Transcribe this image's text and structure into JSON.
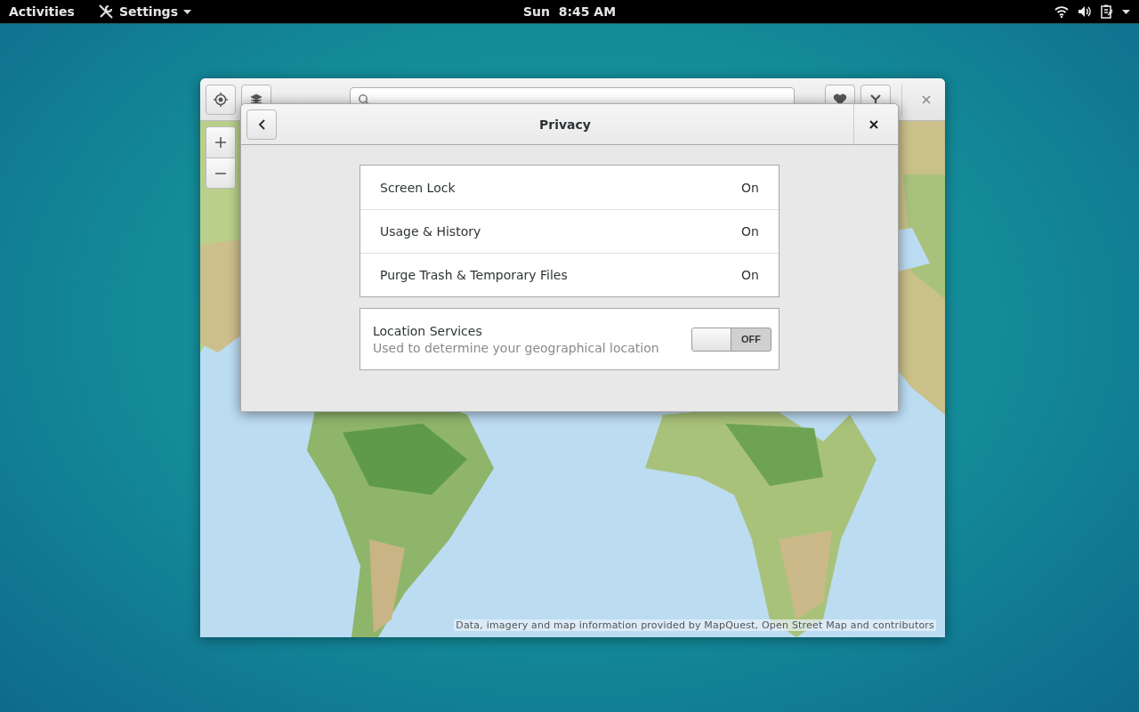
{
  "top_bar": {
    "activities": "Activities",
    "app_menu": "Settings",
    "clock": "Sun  8:45 AM"
  },
  "maps_window": {
    "attribution": "Data, imagery and map information provided by MapQuest, Open Street Map and contributors"
  },
  "dialog": {
    "title": "Privacy",
    "rows": [
      {
        "label": "Screen Lock",
        "value": "On"
      },
      {
        "label": "Usage & History",
        "value": "On"
      },
      {
        "label": "Purge Trash & Temporary Files",
        "value": "On"
      }
    ],
    "location_services": {
      "title": "Location Services",
      "subtitle": "Used to determine your geographical location",
      "on": false,
      "state_label": "OFF"
    }
  }
}
